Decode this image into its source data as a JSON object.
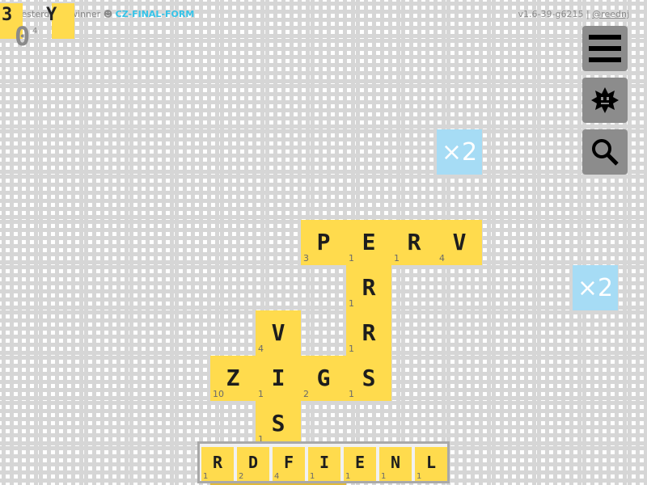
{
  "header": {
    "yesterday_label": "yesterday's winner",
    "separator": "☻",
    "winner_name": "CZ-FINAL-FORM",
    "version": "v1.6-39-g6215",
    "divider": "|",
    "handle": "@reednj"
  },
  "yesterday": {
    "letters": [
      "3",
      "Y"
    ],
    "score_digit": "0",
    "points": "4"
  },
  "board": {
    "tiles": [
      {
        "letter": "P",
        "points": "3"
      },
      {
        "letter": "E",
        "points": "1"
      },
      {
        "letter": "R",
        "points": "1"
      },
      {
        "letter": "V",
        "points": "4"
      },
      {
        "letter": "R",
        "points": "1"
      },
      {
        "letter": "R",
        "points": "1"
      },
      {
        "letter": "V",
        "points": "4"
      },
      {
        "letter": "Z",
        "points": "10"
      },
      {
        "letter": "I",
        "points": "1"
      },
      {
        "letter": "G",
        "points": "2"
      },
      {
        "letter": "S",
        "points": "1"
      },
      {
        "letter": "S",
        "points": "1"
      }
    ],
    "multipliers": [
      "×2",
      "×2"
    ]
  },
  "rack": {
    "tiles": [
      {
        "letter": "R",
        "points": "1"
      },
      {
        "letter": "D",
        "points": "2"
      },
      {
        "letter": "F",
        "points": "4"
      },
      {
        "letter": "I",
        "points": "1"
      },
      {
        "letter": "E",
        "points": "1"
      },
      {
        "letter": "N",
        "points": "1"
      },
      {
        "letter": "L",
        "points": "1"
      }
    ]
  },
  "controls": {
    "menu_icon": "hamburger-menu-icon",
    "star_icon": "star-face-icon",
    "search_icon": "search-icon"
  },
  "colors": {
    "tile": "#ffdb4d",
    "multiplier": "#a6dcf5",
    "winner": "#35c3e8",
    "button": "#8c8c8c"
  }
}
